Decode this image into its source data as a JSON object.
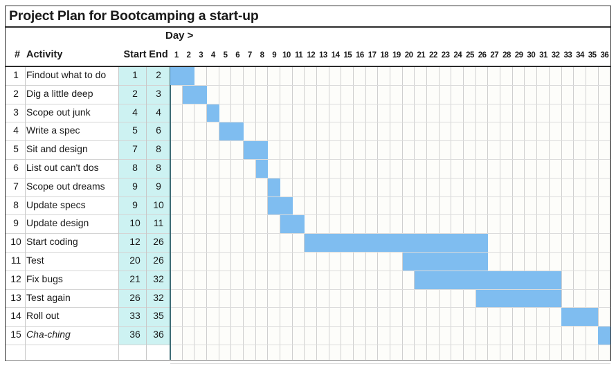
{
  "title": "Project Plan for Bootcamping a start-up",
  "header": {
    "day_label": "Day >",
    "col_hash": "#",
    "col_activity": "Activity",
    "col_start": "Start",
    "col_end": "End"
  },
  "colors": {
    "bar": "#7fbdf0",
    "start_end_tint": "#cdf2f2",
    "grid_line": "#cfcfcf",
    "border": "#2b2b2b"
  },
  "chart_data": {
    "type": "bar",
    "title": "Project Plan for Bootcamping a start-up",
    "xlabel": "Day >",
    "ylabel": "Activity",
    "xlim": [
      1,
      36
    ],
    "grid": true,
    "legend": "none",
    "day_ticks": [
      1,
      2,
      3,
      4,
      5,
      6,
      7,
      8,
      9,
      10,
      11,
      12,
      13,
      14,
      15,
      16,
      17,
      18,
      19,
      20,
      21,
      22,
      23,
      24,
      25,
      26,
      27,
      28,
      29,
      30,
      31,
      32,
      33,
      34,
      35,
      36
    ],
    "categories": [
      "Findout what to do",
      "Dig a little deep",
      "Scope out junk",
      "Write a spec",
      "Sit and design",
      "List out can't dos",
      "Scope out dreams",
      "Update specs",
      "Update design",
      "Start coding",
      "Test",
      "Fix bugs",
      "Test again",
      "Roll out",
      "Cha-ching"
    ],
    "rows": [
      {
        "num": "1",
        "activity": "Findout what to do",
        "start": "1",
        "end": "2",
        "start_val": 1,
        "end_val": 2,
        "duration": 2,
        "italic": false
      },
      {
        "num": "2",
        "activity": "Dig a little deep",
        "start": "2",
        "end": "3",
        "start_val": 2,
        "end_val": 3,
        "duration": 2,
        "italic": false
      },
      {
        "num": "3",
        "activity": "Scope out junk",
        "start": "4",
        "end": "4",
        "start_val": 4,
        "end_val": 4,
        "duration": 1,
        "italic": false
      },
      {
        "num": "4",
        "activity": "Write a spec",
        "start": "5",
        "end": "6",
        "start_val": 5,
        "end_val": 6,
        "duration": 2,
        "italic": false
      },
      {
        "num": "5",
        "activity": "Sit and design",
        "start": "7",
        "end": "8",
        "start_val": 7,
        "end_val": 8,
        "duration": 2,
        "italic": false
      },
      {
        "num": "6",
        "activity": "List out can't dos",
        "start": "8",
        "end": "8",
        "start_val": 8,
        "end_val": 8,
        "duration": 1,
        "italic": false
      },
      {
        "num": "7",
        "activity": "Scope out dreams",
        "start": "9",
        "end": "9",
        "start_val": 9,
        "end_val": 9,
        "duration": 1,
        "italic": false
      },
      {
        "num": "8",
        "activity": "Update specs",
        "start": "9",
        "end": "10",
        "start_val": 9,
        "end_val": 10,
        "duration": 2,
        "italic": false
      },
      {
        "num": "9",
        "activity": "Update design",
        "start": "10",
        "end": "11",
        "start_val": 10,
        "end_val": 11,
        "duration": 2,
        "italic": false
      },
      {
        "num": "10",
        "activity": "Start coding",
        "start": "12",
        "end": "26",
        "start_val": 12,
        "end_val": 26,
        "duration": 15,
        "italic": false
      },
      {
        "num": "11",
        "activity": "Test",
        "start": "20",
        "end": "26",
        "start_val": 20,
        "end_val": 26,
        "duration": 7,
        "italic": false
      },
      {
        "num": "12",
        "activity": "Fix bugs",
        "start": "21",
        "end": "32",
        "start_val": 21,
        "end_val": 32,
        "duration": 12,
        "italic": false
      },
      {
        "num": "13",
        "activity": "Test again",
        "start": "26",
        "end": "32",
        "start_val": 26,
        "end_val": 32,
        "duration": 7,
        "italic": false
      },
      {
        "num": "14",
        "activity": "Roll out",
        "start": "33",
        "end": "35",
        "start_val": 33,
        "end_val": 35,
        "duration": 3,
        "italic": false
      },
      {
        "num": "15",
        "activity": "Cha-ching",
        "start": "36",
        "end": "36",
        "start_val": 36,
        "end_val": 36,
        "duration": 1,
        "italic": true
      }
    ]
  }
}
